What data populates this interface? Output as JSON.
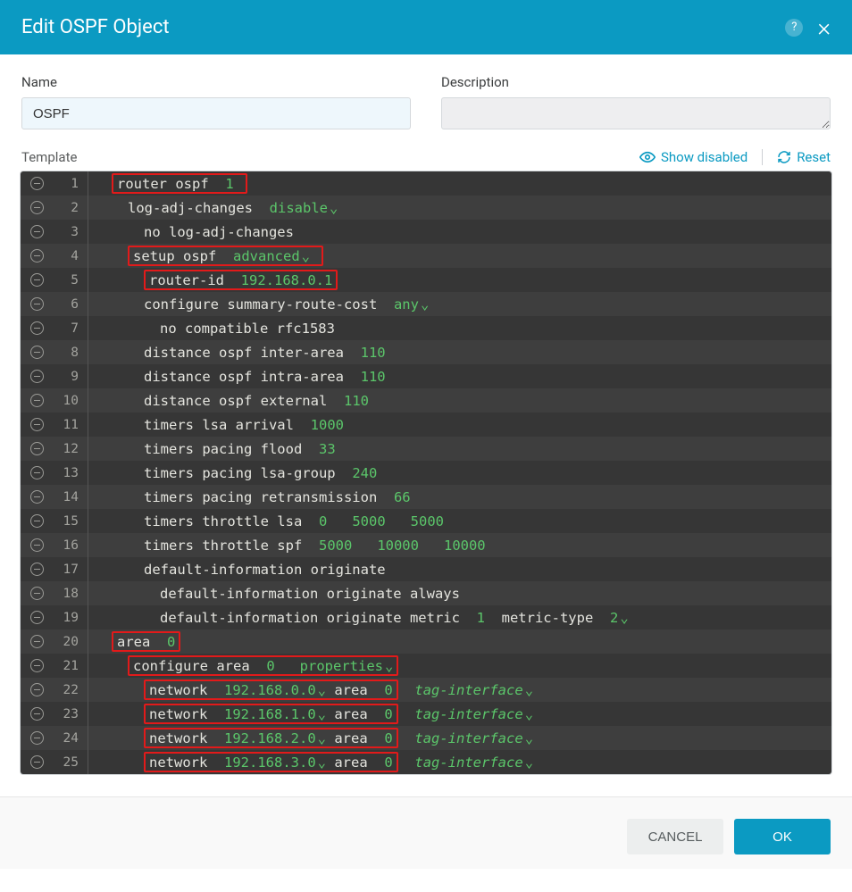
{
  "header": {
    "title": "Edit OSPF Object"
  },
  "fields": {
    "name_label": "Name",
    "name_value": "OSPF",
    "desc_label": "Description",
    "desc_value": ""
  },
  "toolbar": {
    "template_label": "Template",
    "show_disabled": "Show disabled",
    "reset": "Reset"
  },
  "lines": {
    "l1": {
      "text": "router ospf",
      "val": "1"
    },
    "l2": {
      "text": "log-adj-changes",
      "val": "disable"
    },
    "l3": {
      "text": "no log-adj-changes"
    },
    "l4": {
      "text": "setup ospf",
      "val": "advanced"
    },
    "l5": {
      "text": "router-id",
      "val": "192.168.0.1"
    },
    "l6": {
      "text": "configure summary-route-cost",
      "val": "any"
    },
    "l7": {
      "text": "no compatible rfc1583"
    },
    "l8": {
      "text": "distance ospf inter-area",
      "val": "110"
    },
    "l9": {
      "text": "distance ospf intra-area",
      "val": "110"
    },
    "l10": {
      "text": "distance ospf external",
      "val": "110"
    },
    "l11": {
      "text": "timers lsa arrival",
      "val": "1000"
    },
    "l12": {
      "text": "timers pacing flood",
      "val": "33"
    },
    "l13": {
      "text": "timers pacing lsa-group",
      "val": "240"
    },
    "l14": {
      "text": "timers pacing retransmission",
      "val": "66"
    },
    "l15": {
      "text": "timers throttle lsa",
      "v1": "0",
      "v2": "5000",
      "v3": "5000"
    },
    "l16": {
      "text": "timers throttle spf",
      "v1": "5000",
      "v2": "10000",
      "v3": "10000"
    },
    "l17": {
      "text": "default-information originate"
    },
    "l18": {
      "text": "default-information originate always"
    },
    "l19": {
      "text": "default-information originate metric",
      "v1": "1",
      "mid": "metric-type",
      "v2": "2"
    },
    "l20": {
      "text": "area",
      "val": "0"
    },
    "l21": {
      "text": "configure area",
      "v1": "0",
      "v2": "properties"
    },
    "l22": {
      "text": "network",
      "ip": "192.168.0.0",
      "mid": "area",
      "area": "0",
      "tag": "tag-interface"
    },
    "l23": {
      "text": "network",
      "ip": "192.168.1.0",
      "mid": "area",
      "area": "0",
      "tag": "tag-interface"
    },
    "l24": {
      "text": "network",
      "ip": "192.168.2.0",
      "mid": "area",
      "area": "0",
      "tag": "tag-interface"
    },
    "l25": {
      "text": "network",
      "ip": "192.168.3.0",
      "mid": "area",
      "area": "0",
      "tag": "tag-interface"
    }
  },
  "line_numbers": {
    "n1": "1",
    "n2": "2",
    "n3": "3",
    "n4": "4",
    "n5": "5",
    "n6": "6",
    "n7": "7",
    "n8": "8",
    "n9": "9",
    "n10": "10",
    "n11": "11",
    "n12": "12",
    "n13": "13",
    "n14": "14",
    "n15": "15",
    "n16": "16",
    "n17": "17",
    "n18": "18",
    "n19": "19",
    "n20": "20",
    "n21": "21",
    "n22": "22",
    "n23": "23",
    "n24": "24",
    "n25": "25"
  },
  "footer": {
    "cancel": "CANCEL",
    "ok": "OK"
  }
}
